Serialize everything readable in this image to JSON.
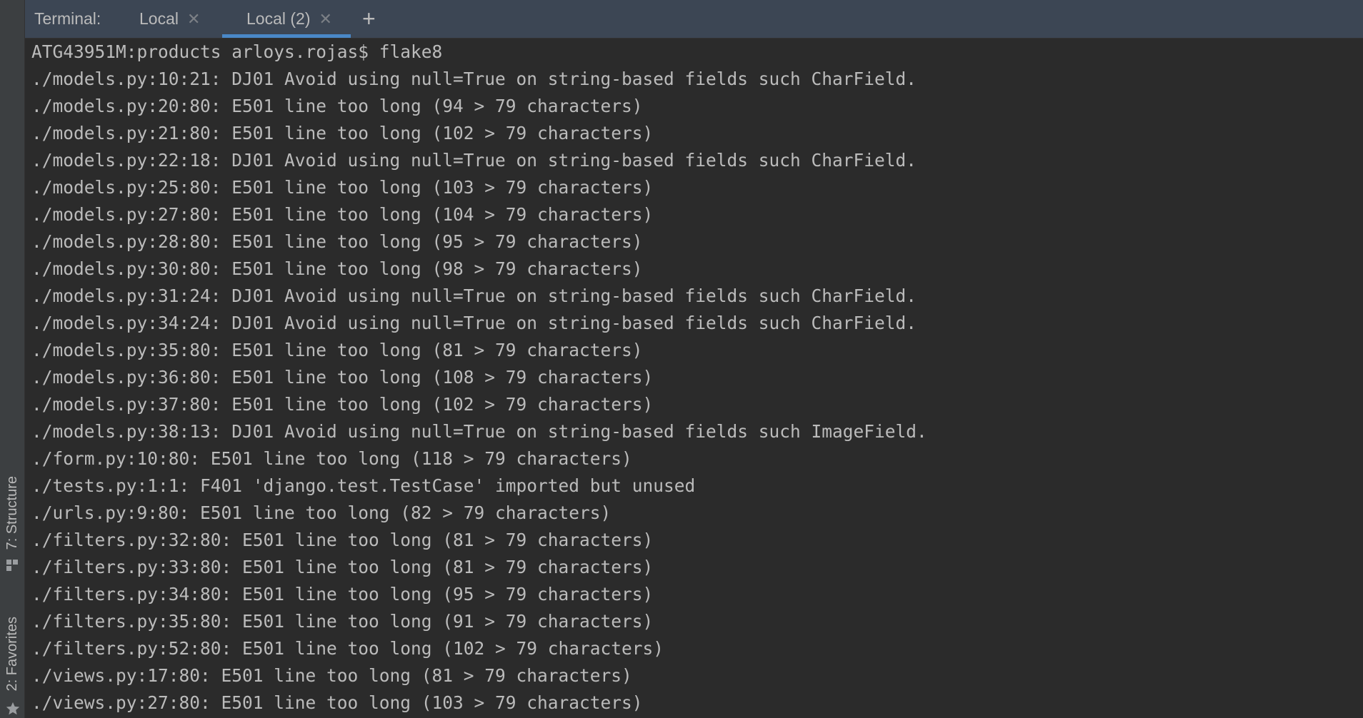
{
  "sidebar": {
    "structure_label": "7: Structure",
    "favorites_label": "2: Favorites",
    "structure_icon": "structure-icon",
    "favorites_icon": "star-icon"
  },
  "terminal": {
    "title": "Terminal:",
    "tabs": [
      {
        "label": "Local",
        "close_icon": "close-icon"
      },
      {
        "label": "Local (2)",
        "close_icon": "close-icon",
        "active": true
      }
    ],
    "add_tab_icon": "plus-icon",
    "lines": [
      "ATG43951M:products arloys.rojas$ flake8",
      "./models.py:10:21: DJ01 Avoid using null=True on string-based fields such CharField.",
      "./models.py:20:80: E501 line too long (94 > 79 characters)",
      "./models.py:21:80: E501 line too long (102 > 79 characters)",
      "./models.py:22:18: DJ01 Avoid using null=True on string-based fields such CharField.",
      "./models.py:25:80: E501 line too long (103 > 79 characters)",
      "./models.py:27:80: E501 line too long (104 > 79 characters)",
      "./models.py:28:80: E501 line too long (95 > 79 characters)",
      "./models.py:30:80: E501 line too long (98 > 79 characters)",
      "./models.py:31:24: DJ01 Avoid using null=True on string-based fields such CharField.",
      "./models.py:34:24: DJ01 Avoid using null=True on string-based fields such CharField.",
      "./models.py:35:80: E501 line too long (81 > 79 characters)",
      "./models.py:36:80: E501 line too long (108 > 79 characters)",
      "./models.py:37:80: E501 line too long (102 > 79 characters)",
      "./models.py:38:13: DJ01 Avoid using null=True on string-based fields such ImageField.",
      "./form.py:10:80: E501 line too long (118 > 79 characters)",
      "./tests.py:1:1: F401 'django.test.TestCase' imported but unused",
      "./urls.py:9:80: E501 line too long (82 > 79 characters)",
      "./filters.py:32:80: E501 line too long (81 > 79 characters)",
      "./filters.py:33:80: E501 line too long (81 > 79 characters)",
      "./filters.py:34:80: E501 line too long (95 > 79 characters)",
      "./filters.py:35:80: E501 line too long (91 > 79 characters)",
      "./filters.py:52:80: E501 line too long (102 > 79 characters)",
      "./views.py:17:80: E501 line too long (81 > 79 characters)",
      "./views.py:27:80: E501 line too long (103 > 79 characters)"
    ]
  },
  "colors": {
    "background": "#2b2b2b",
    "tabbar": "#3c4654",
    "text": "#bbbbbb",
    "active_tab_underline": "#4a88c7"
  }
}
